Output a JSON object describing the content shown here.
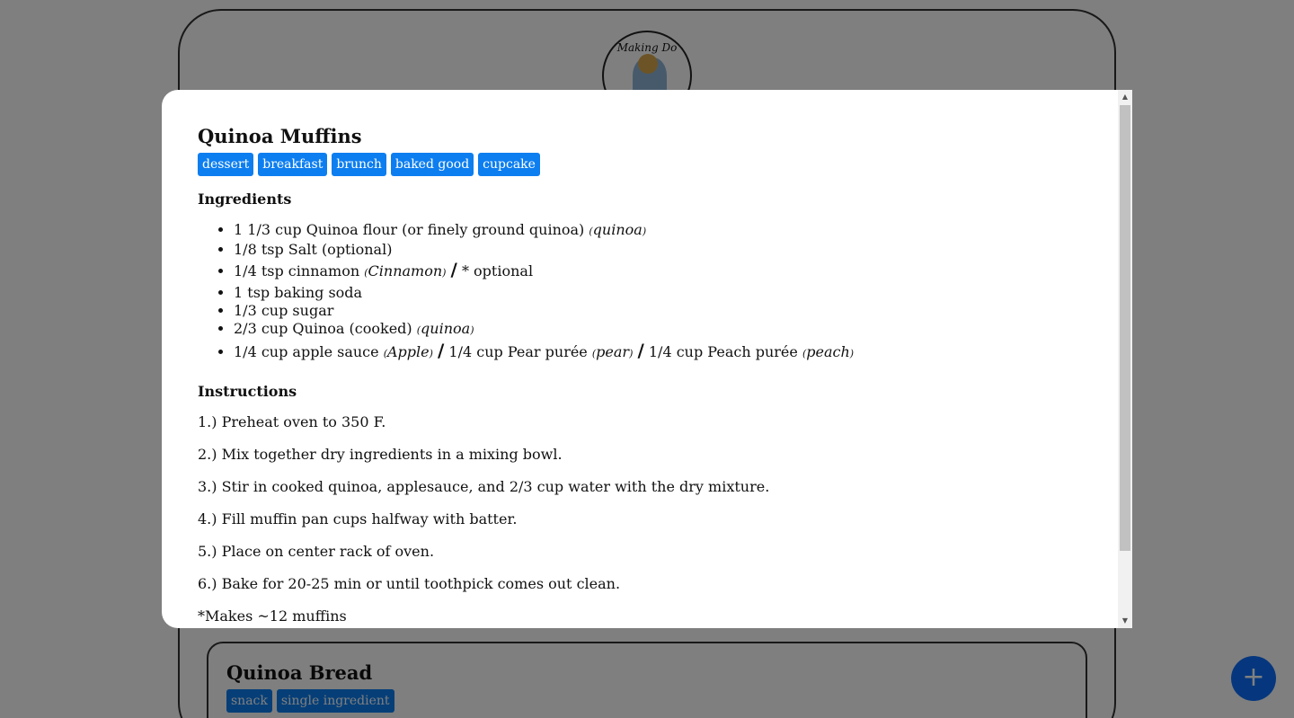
{
  "background": {
    "logo_text": "Making Do",
    "card": {
      "title": "Quinoa Bread",
      "tags": [
        "snack",
        "single ingredient"
      ]
    },
    "fab_label": "+"
  },
  "modal": {
    "title": "Quinoa Muffins",
    "tags": [
      "dessert",
      "breakfast",
      "brunch",
      "baked good",
      "cupcake"
    ],
    "ingredients_heading": "Ingredients",
    "ingredients": [
      {
        "text": "1 1/3 cup Quinoa flour (or finely ground quinoa)",
        "tag": "quinoa"
      },
      {
        "text": "1/8 tsp Salt (optional)"
      },
      {
        "text": "1/4 tsp cinnamon",
        "tag": "Cinnamon",
        "alt": "* optional"
      },
      {
        "text": "1 tsp baking soda"
      },
      {
        "text": "1/3 cup sugar"
      },
      {
        "text": "2/3 cup Quinoa (cooked)",
        "tag": "quinoa"
      },
      {
        "text": "1/4 cup apple sauce",
        "tag": "Apple",
        "alt1": "1/4 cup Pear purée",
        "alt1_tag": "pear",
        "alt2": "1/4 cup Peach purée",
        "alt2_tag": "peach"
      }
    ],
    "instructions_heading": "Instructions",
    "instructions": [
      "1.) Preheat oven to 350 F.",
      "2.) Mix together dry ingredients in a mixing bowl.",
      "3.) Stir in cooked quinoa, applesauce, and 2/3 cup water with the dry mixture.",
      "4.) Fill muffin pan cups halfway with batter.",
      "5.) Place on center rack of oven.",
      "6.) Bake for 20-25 min or until toothpick comes out clean.",
      "*Makes ~12 muffins"
    ]
  },
  "colors": {
    "tag_bg": "#0d7ef0",
    "fab_bg": "#0d6efd",
    "overlay": "rgba(0,0,0,0.5)"
  }
}
